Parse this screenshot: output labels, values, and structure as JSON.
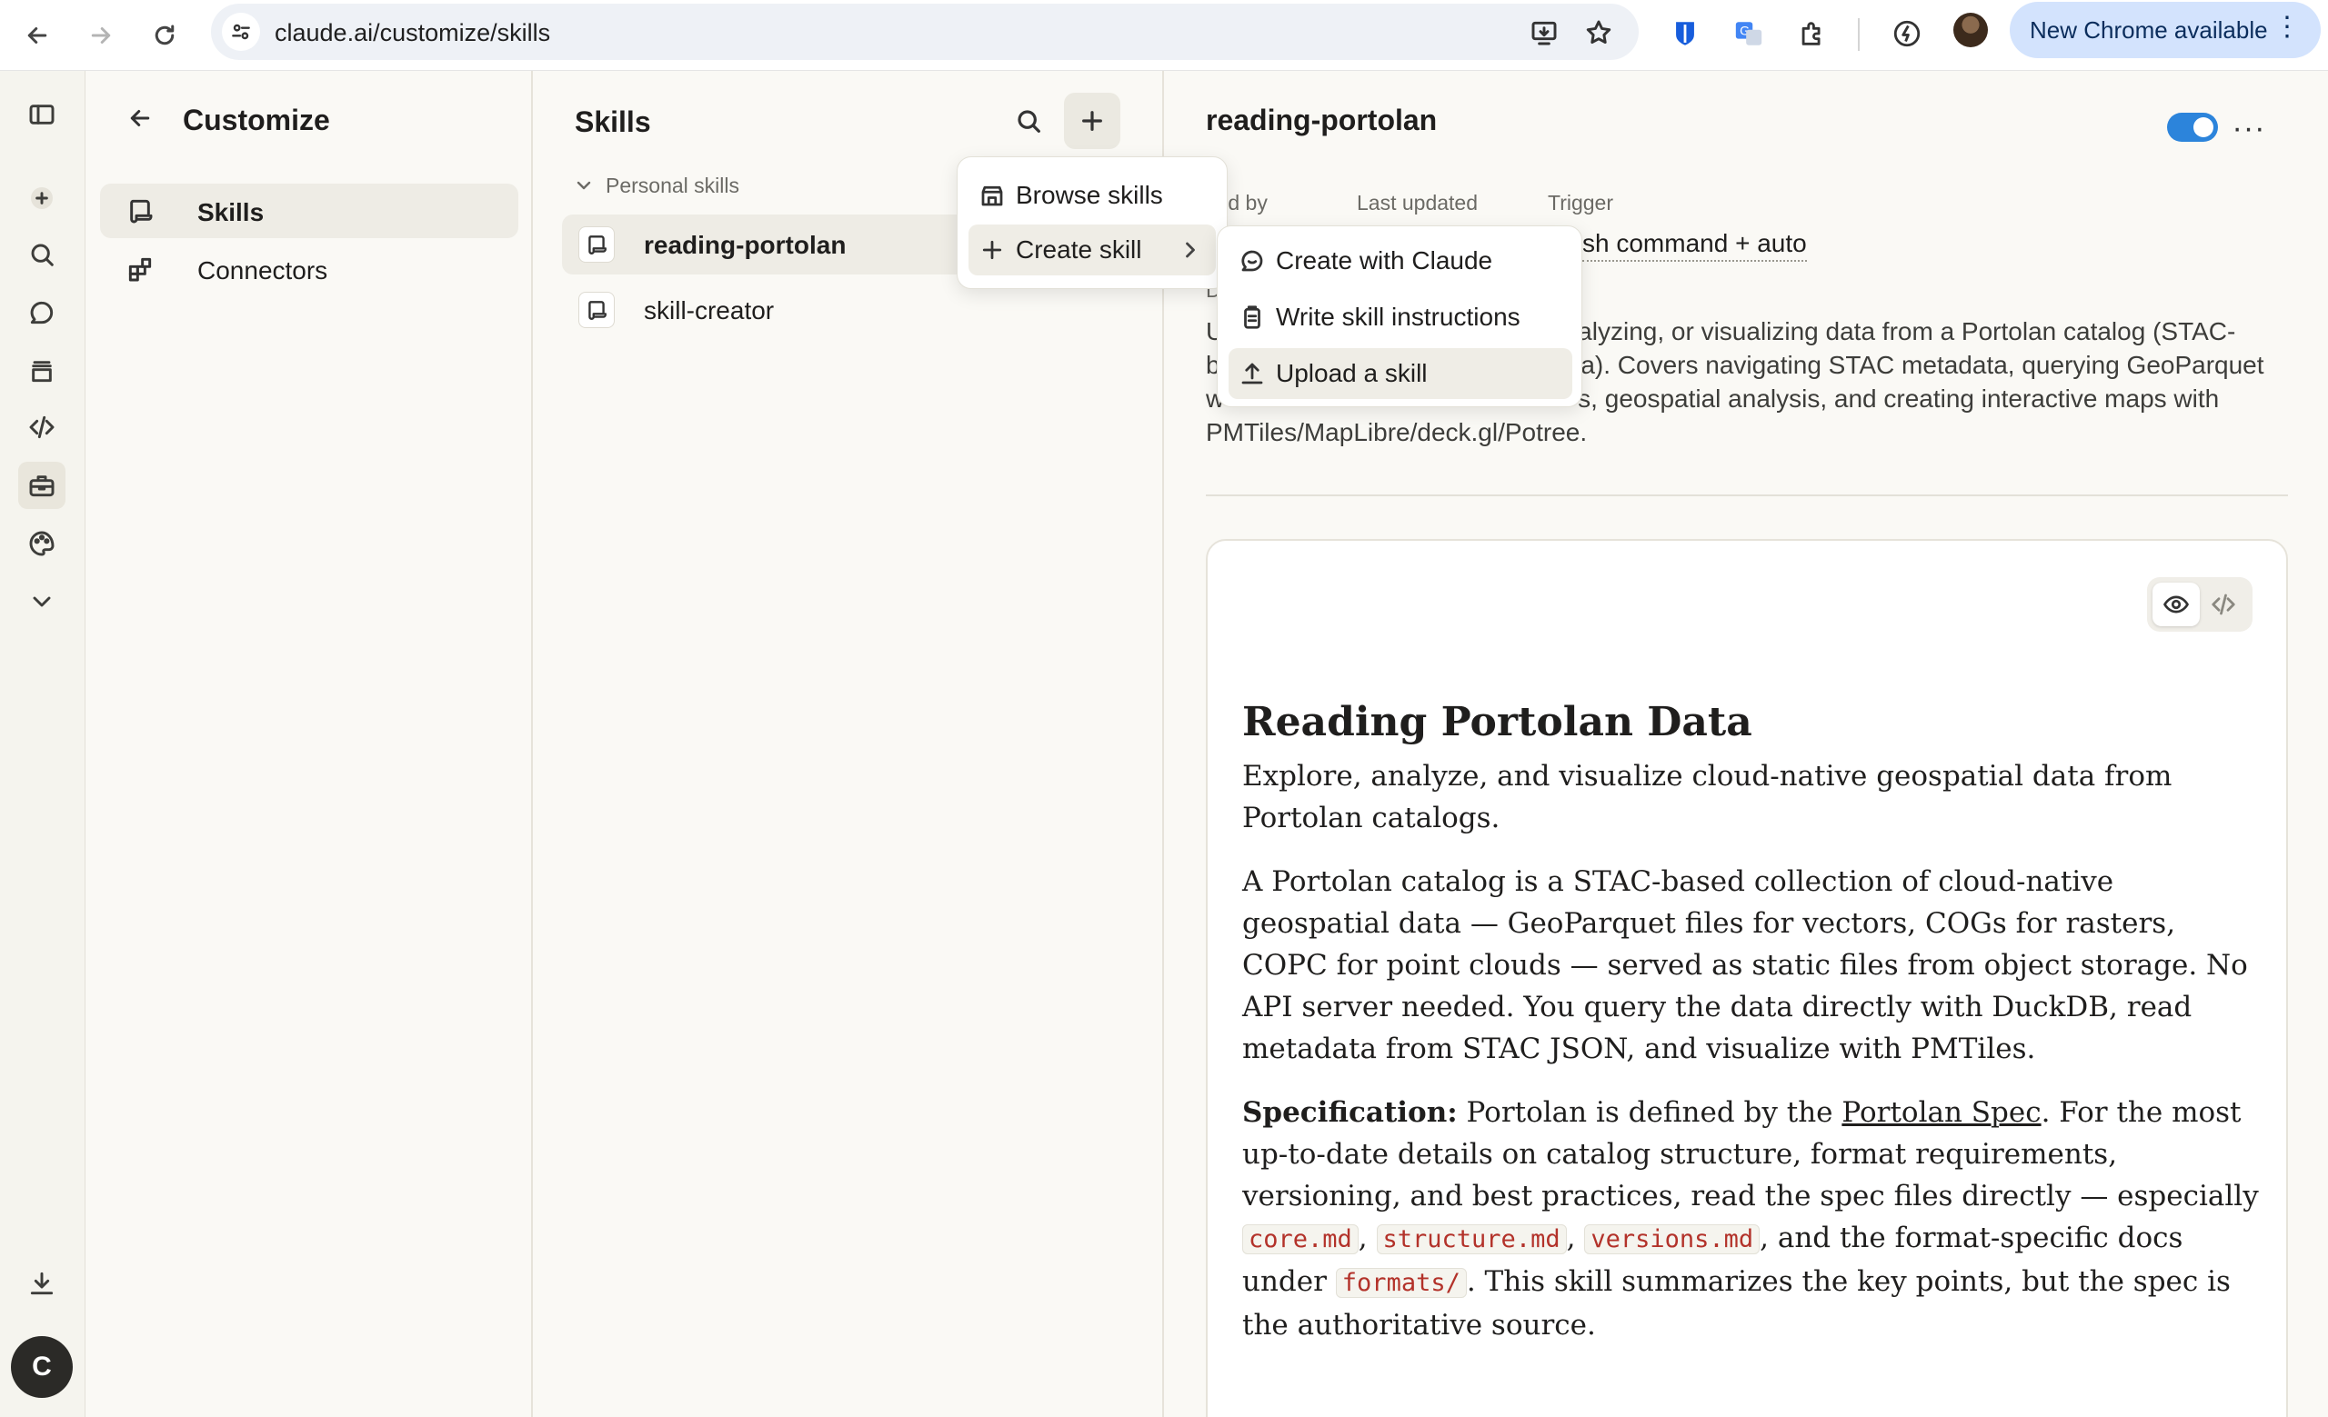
{
  "browser": {
    "url": "claude.ai/customize/skills",
    "update_label": "New Chrome available",
    "menu_dots": "⋮"
  },
  "rail": {
    "avatar_initial": "C"
  },
  "customize": {
    "title": "Customize",
    "items": [
      {
        "label": "Skills",
        "active": true
      },
      {
        "label": "Connectors",
        "active": false
      }
    ]
  },
  "skills": {
    "title": "Skills",
    "group_label": "Personal skills",
    "items": [
      {
        "label": "reading-portolan",
        "active": true
      },
      {
        "label": "skill-creator",
        "active": false
      }
    ]
  },
  "add_menu": {
    "items": [
      {
        "label": "Browse skills",
        "icon": "store-icon"
      },
      {
        "label": "Create skill",
        "icon": "plus-icon",
        "has_submenu": true
      }
    ]
  },
  "create_submenu": {
    "items": [
      {
        "label": "Create with Claude",
        "icon": "chat-icon"
      },
      {
        "label": "Write skill instructions",
        "icon": "clipboard-icon"
      },
      {
        "label": "Upload a skill",
        "icon": "upload-icon",
        "highlighted": true
      }
    ]
  },
  "detail": {
    "title": "reading-portolan",
    "enabled": true,
    "more_label": "···",
    "meta": {
      "added_by_label": "dded by",
      "last_updated_label": "Last updated",
      "trigger_label": "Trigger",
      "trigger_value": "sh command + auto"
    },
    "description_label": "D",
    "description_lines": [
      "U                                                  alyzing, or visualizing data from a Portolan catalog (STAC-",
      "b                                                  ta). Covers navigating STAC metadata, querying GeoParquet",
      "w                                                  s, geospatial analysis, and creating interactive maps with",
      "PMTiles/MapLibre/deck.gl/Potree."
    ],
    "doc": {
      "heading": "Reading Portolan Data",
      "intro": "Explore, analyze, and visualize cloud-native geospatial data from Portolan catalogs.",
      "paragraph1": "A Portolan catalog is a STAC-based collection of cloud-native geospatial data — GeoParquet files for vectors, COGs for rasters, COPC for point clouds — served as static files from object storage. No API server needed. You query the data directly with DuckDB, read metadata from STAC JSON, and visualize with PMTiles.",
      "spec_label": "Specification:",
      "spec_text1": " Portolan is defined by the ",
      "spec_link": "Portolan Spec",
      "spec_text2": ". For the most up-to-date details on catalog structure, format requirements, versioning, and best practices, read the spec files directly — especially ",
      "code1": "core.md",
      "sep1": ", ",
      "code2": "structure.md",
      "sep2": ", ",
      "code3": "versions.md",
      "spec_text3": ", and the format-specific docs under ",
      "code4": "formats/",
      "spec_text4": ". This skill summarizes the key points, but the spec is the authoritative source."
    }
  },
  "colors": {
    "accent_toggle": "#2c84db",
    "update_pill": "#d3e3fd",
    "code_text": "#b3322a",
    "page_bg": "#faf9f5"
  }
}
